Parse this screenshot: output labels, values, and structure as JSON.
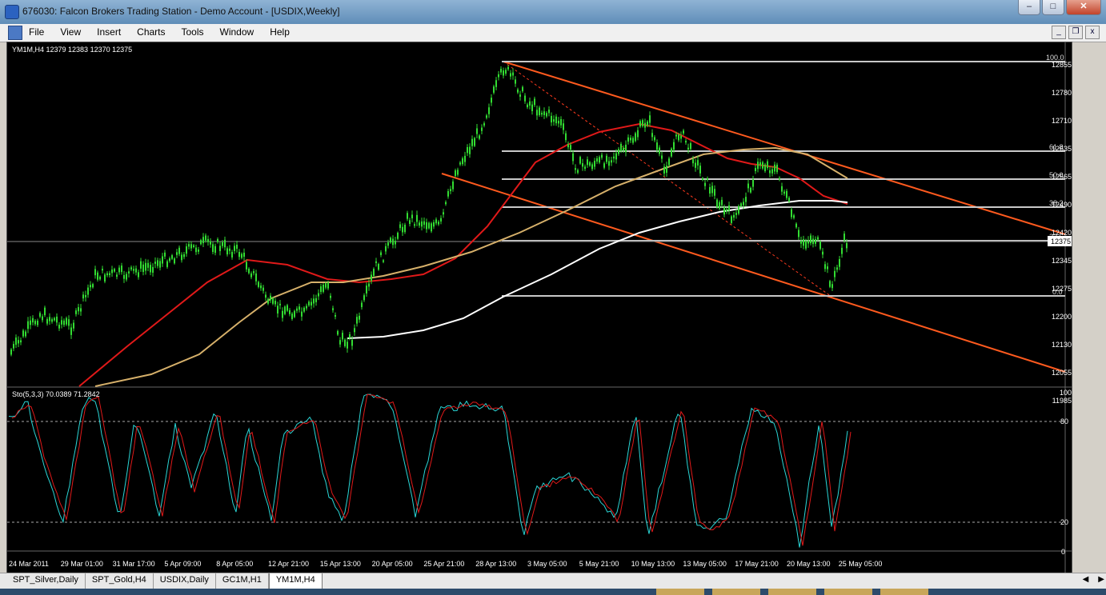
{
  "window": {
    "title": "676030: Falcon Brokers Trading Station - Demo Account - [USDIX,Weekly]"
  },
  "menu": [
    "File",
    "View",
    "Insert",
    "Charts",
    "Tools",
    "Window",
    "Help"
  ],
  "price_chart": {
    "label": "YM1M,H4  12379 12383 12370 12375",
    "current_price": "12375",
    "price_labels": [
      "12855",
      "12780",
      "12710",
      "12635",
      "12565",
      "12490",
      "12420",
      "12345",
      "12275",
      "12200",
      "12130",
      "12055",
      "11985"
    ],
    "fib_levels": [
      "100.0",
      "61.8",
      "50.0",
      "38.2",
      "23.6",
      "0.0"
    ],
    "colors": {
      "candles": "#32dc32",
      "ma_red": "#e01919",
      "ma_tan": "#d6b06a",
      "ma_white": "#ffffff",
      "trend": "#ff5a1e",
      "fib": "#c8c8c8"
    }
  },
  "stochastic": {
    "label": "Sto(5,3,3) 70.0389 71.2842",
    "levels": [
      "100",
      "80",
      "20",
      "0"
    ],
    "colors": {
      "main": "#2ad6d6",
      "signal": "#e01919"
    }
  },
  "time_axis": [
    "24 Mar 2011",
    "29 Mar 01:00",
    "31 Mar 17:00",
    "5 Apr 09:00",
    "8 Apr 05:00",
    "12 Apr 21:00",
    "15 Apr 13:00",
    "20 Apr 05:00",
    "25 Apr 21:00",
    "28 Apr 13:00",
    "3 May 05:00",
    "5 May 21:00",
    "10 May 13:00",
    "13 May 05:00",
    "17 May 21:00",
    "20 May 13:00",
    "25 May 05:00"
  ],
  "tabs": [
    {
      "label": "SPT_Silver,Daily",
      "active": false
    },
    {
      "label": "SPT_Gold,H4",
      "active": false
    },
    {
      "label": "USDIX,Daily",
      "active": false
    },
    {
      "label": "GC1M,H1",
      "active": false
    },
    {
      "label": "YM1M,H4",
      "active": true
    }
  ]
}
